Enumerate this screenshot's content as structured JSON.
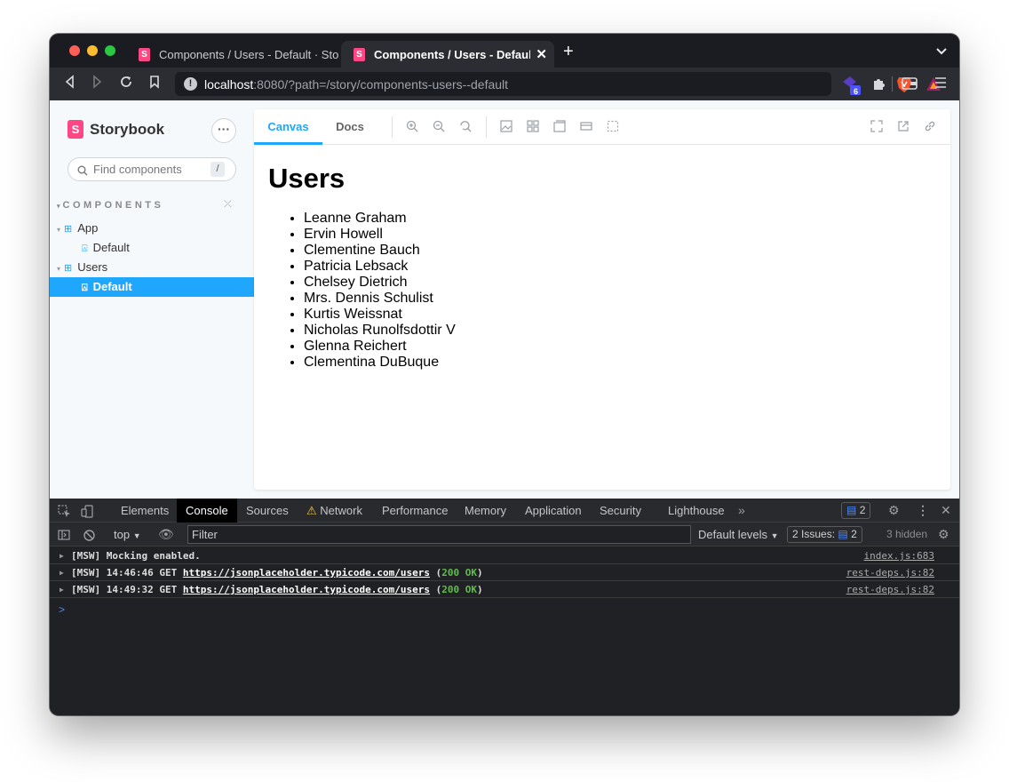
{
  "browser": {
    "tabs": [
      {
        "title": "Components / Users - Default · Storybook"
      },
      {
        "title": "Components / Users - Default ·"
      }
    ],
    "url_host": "localhost",
    "url_rest": ":8080/?path=/story/components-users--default",
    "extension_badge": "6"
  },
  "storybook": {
    "brand": "Storybook",
    "brand_mark": "S",
    "search_placeholder": "Find components",
    "search_shortcut": "/",
    "section": "COMPONENTS",
    "tree": [
      {
        "label": "App",
        "type": "component"
      },
      {
        "label": "Default",
        "type": "story"
      },
      {
        "label": "Users",
        "type": "component"
      },
      {
        "label": "Default",
        "type": "story",
        "selected": true
      }
    ],
    "tabs": {
      "canvas": "Canvas",
      "docs": "Docs"
    },
    "preview": {
      "heading": "Users",
      "users": [
        "Leanne Graham",
        "Ervin Howell",
        "Clementine Bauch",
        "Patricia Lebsack",
        "Chelsey Dietrich",
        "Mrs. Dennis Schulist",
        "Kurtis Weissnat",
        "Nicholas Runolfsdottir V",
        "Glenna Reichert",
        "Clementina DuBuque"
      ]
    }
  },
  "devtools": {
    "tabs": [
      "Elements",
      "Console",
      "Sources",
      "Network",
      "Performance",
      "Memory",
      "Application",
      "Security",
      "Lighthouse"
    ],
    "messages_badge": "2",
    "context": "top",
    "filter_placeholder": "Filter",
    "levels": "Default levels",
    "issues_label": "2 Issues:",
    "issues_count": "2",
    "hidden": "3 hidden",
    "logs": [
      {
        "text": "[MSW] Mocking enabled.",
        "source": "index.js:683"
      },
      {
        "prefix": "[MSW] 14:46:46 GET ",
        "url": "https://jsonplaceholder.typicode.com/users",
        "open": " (",
        "status": "200 OK",
        "close": ")",
        "source": "rest-deps.js:82"
      },
      {
        "prefix": "[MSW] 14:49:32 GET ",
        "url": "https://jsonplaceholder.typicode.com/users",
        "open": " (",
        "status": "200 OK",
        "close": ")",
        "source": "rest-deps.js:82"
      }
    ],
    "prompt": ">"
  },
  "colors": {
    "accent": "#1ea7fd",
    "brand": "#ff4785",
    "msw_warn": "#ff6b3d",
    "ok": "#5fbd4b"
  }
}
